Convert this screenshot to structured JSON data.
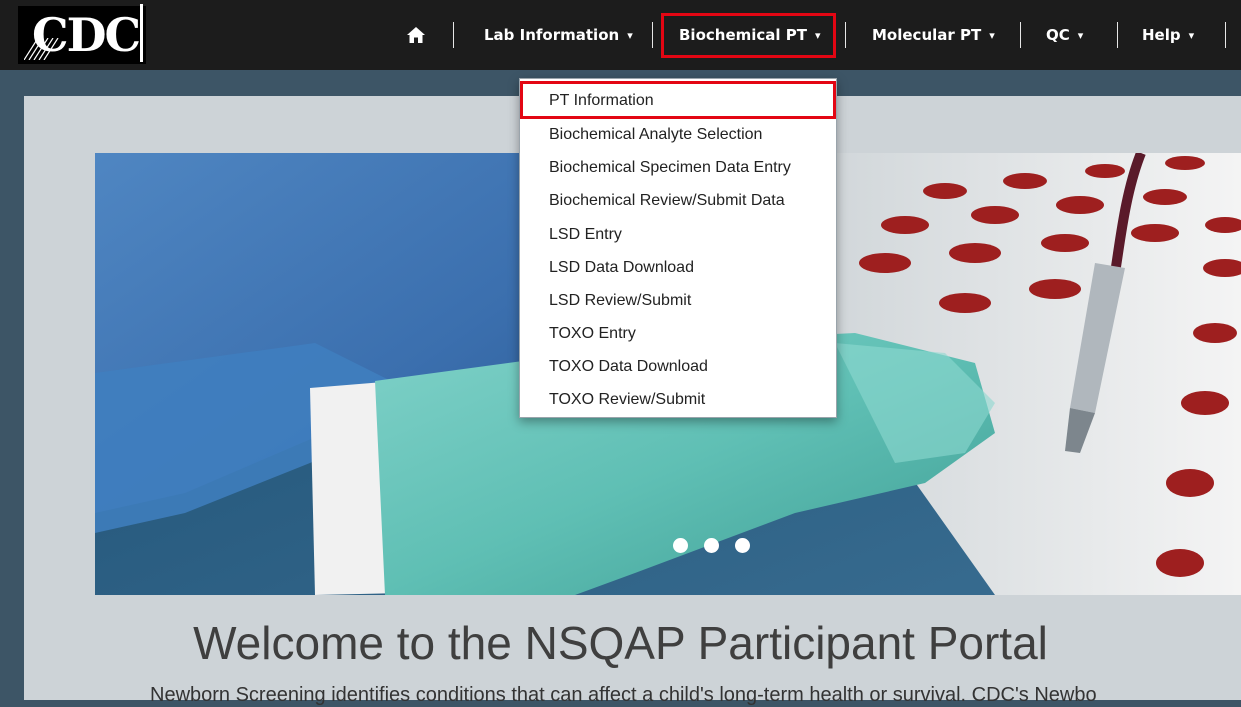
{
  "logo": {
    "text": "CDC"
  },
  "nav": {
    "home_icon": "home-icon",
    "items": [
      {
        "label": "Lab Information",
        "caret": "▾"
      },
      {
        "label": "Biochemical PT",
        "caret": "▾"
      },
      {
        "label": "Molecular PT",
        "caret": "▾"
      },
      {
        "label": "QC",
        "caret": "▾"
      },
      {
        "label": "Help",
        "caret": "▾"
      }
    ]
  },
  "dropdown": {
    "items": [
      "PT Information",
      "Biochemical Analyte Selection",
      "Biochemical Specimen Data Entry",
      "Biochemical Review/Submit Data",
      "LSD Entry",
      "LSD Data Download",
      "LSD Review/Submit",
      "TOXO Entry",
      "TOXO Data Download",
      "TOXO Review/Submit"
    ]
  },
  "carousel": {
    "slide_count": 3
  },
  "welcome": {
    "title": "Welcome to the NSQAP Participant Portal",
    "subtitle": "Newborn Screening identifies conditions that can affect a child's long-term health or survival. CDC's Newbo"
  },
  "colors": {
    "highlight": "#e30613",
    "navbar": "#1c1c1c",
    "frame": "#3d5566"
  }
}
